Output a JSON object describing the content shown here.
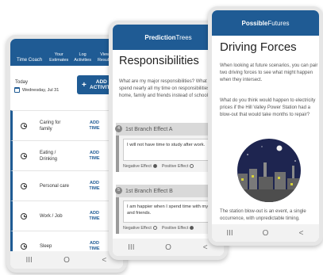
{
  "time_coach": {
    "tabs": [
      "Time Coach",
      "Your Estimates",
      "Log Activities",
      "View Results"
    ],
    "today_label": "Today",
    "date": "Wednesday, Jul 31",
    "add_activity": "ADD ACTIVITY",
    "activities": [
      {
        "name": "Caring for family",
        "action": "ADD TIME"
      },
      {
        "name": "Eating / Drinking",
        "action": "ADD TIME"
      },
      {
        "name": "Personal care",
        "action": "ADD TIME"
      },
      {
        "name": "Work / Job",
        "action": "ADD TIME"
      },
      {
        "name": "Sleep",
        "action": "ADD TIME"
      }
    ]
  },
  "prediction_trees": {
    "brand_bold": "Prediction",
    "brand_light": "Trees",
    "title": "Responsibilities",
    "question": "What are my major responsibilities? What happens if I spend nearly all my time on responsibilities like work, home, family and friends instead of schoolwork?",
    "branches": [
      {
        "num": "4",
        "label": "1st Branch Effect A",
        "text": "I will not have time to study after work.",
        "negative": "Negative Effect",
        "positive": "Positive Effect",
        "selected": "negative"
      },
      {
        "num": "5",
        "label": "1st Branch Effect B",
        "text": "I am happier when I spend time with my family and friends.",
        "negative": "Negative Effect",
        "positive": "Positive Effect",
        "selected": "positive"
      }
    ]
  },
  "possible_futures": {
    "brand_bold": "Possible",
    "brand_light": "Futures",
    "title": "Driving Forces",
    "para1": "When looking at future scenarios, you can pair two driving forces to see what might happen when they intersect.",
    "para2": "What do you think would happen to electricity prices if the Hill Valley Power Station had a blow-out that would take months to repair?",
    "para3": "The station blow-out is an event, a single occurrence, with unpredictable timing."
  },
  "nav": {
    "recent": "III",
    "home": "O",
    "back": "<"
  },
  "colors": {
    "brand_blue": "#1f5b94"
  }
}
